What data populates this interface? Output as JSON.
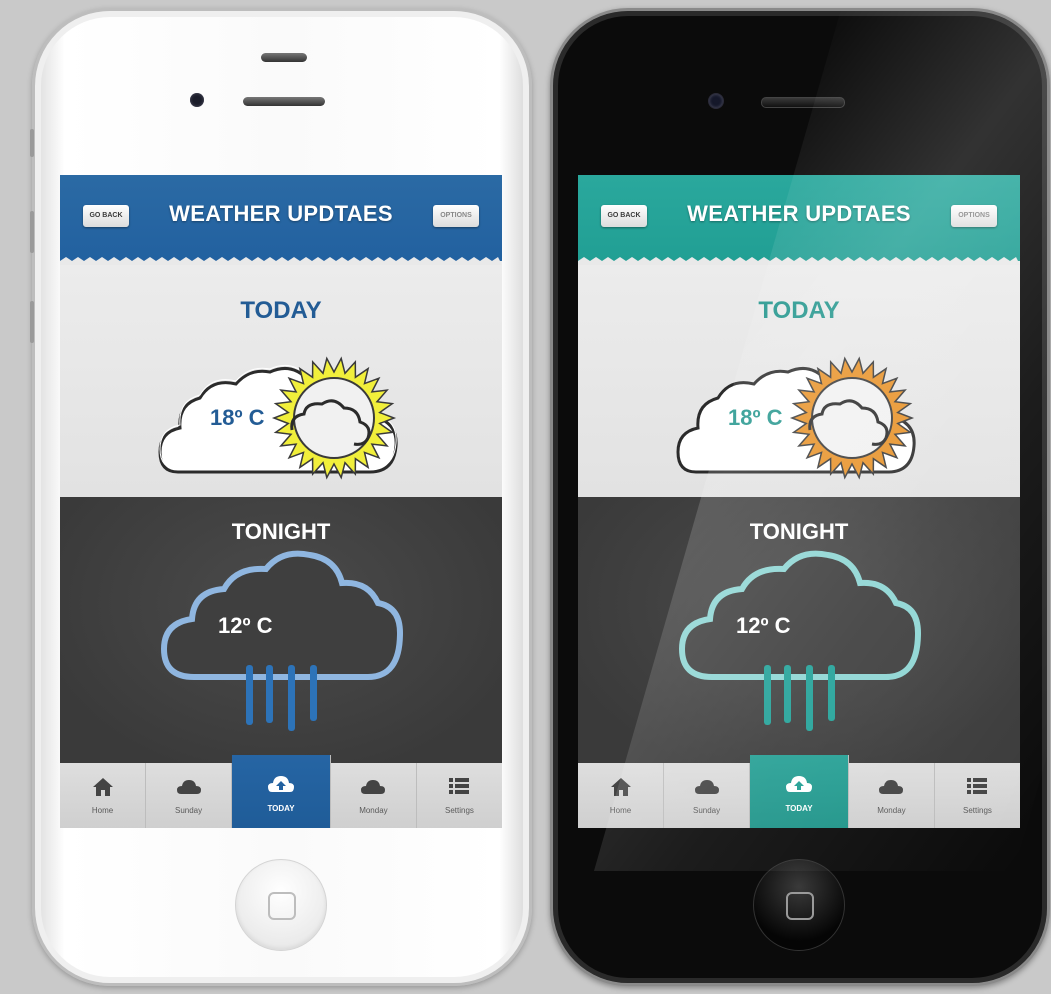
{
  "header": {
    "back_label": "GO BACK",
    "title": "WEATHER UPDTAES",
    "options_label": "OPTIONS"
  },
  "today": {
    "label": "TODAY",
    "temperature": "18º C",
    "condition_icon": "partly-cloudy-icon"
  },
  "tonight": {
    "label": "TONIGHT",
    "temperature": "12º C",
    "condition_icon": "rain-cloud-icon"
  },
  "tabs": [
    {
      "label": "Home",
      "icon": "home-icon"
    },
    {
      "label": "Sunday",
      "icon": "cloud-icon"
    },
    {
      "label": "TODAY",
      "icon": "cloud-upload-icon",
      "active": true
    },
    {
      "label": "Monday",
      "icon": "cloud-icon"
    },
    {
      "label": "Settings",
      "icon": "list-icon"
    }
  ],
  "themes": {
    "white_phone": {
      "accent": "#2261a0",
      "sun": "#f1ef3b"
    },
    "black_phone": {
      "accent": "#219f94",
      "sun": "#e8932a"
    }
  }
}
